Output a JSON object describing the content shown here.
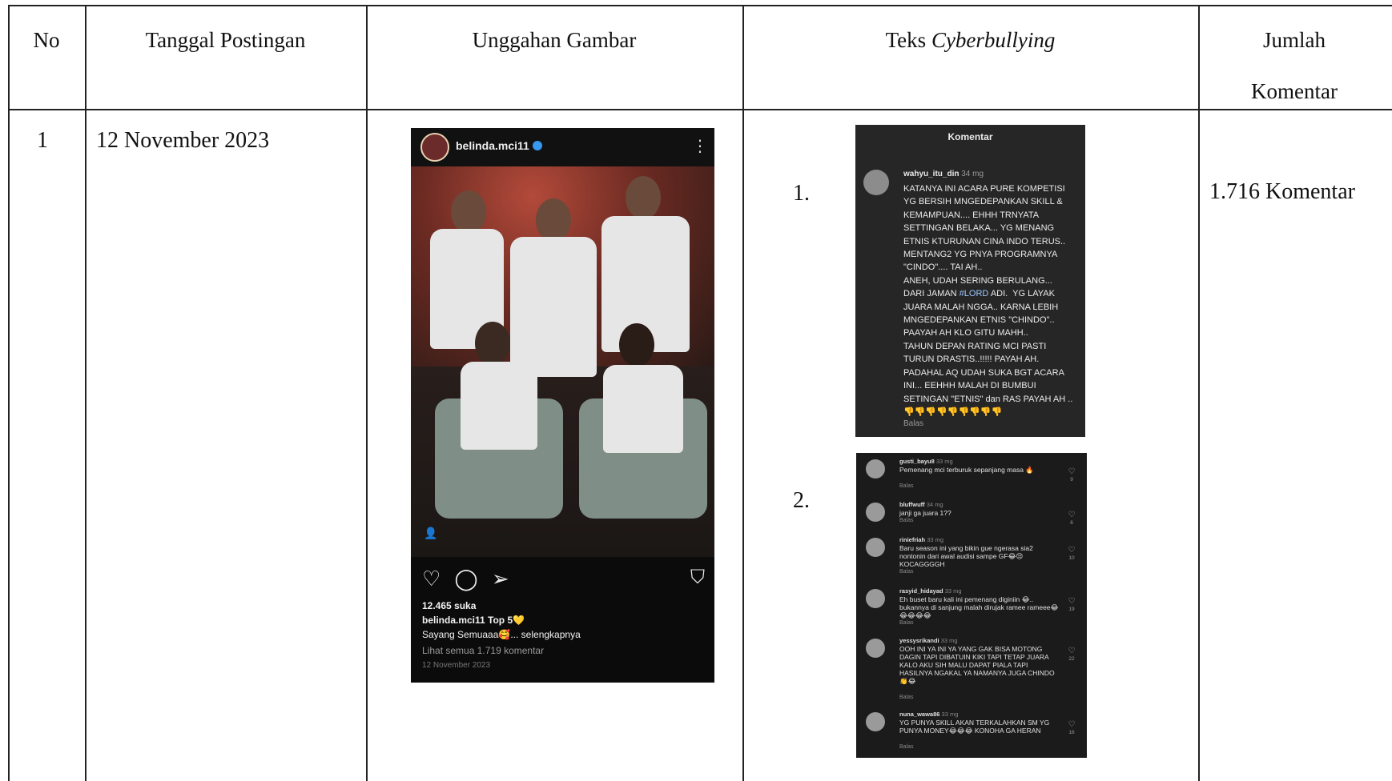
{
  "table": {
    "headers": {
      "no": "No",
      "tanggal": "Tanggal Postingan",
      "unggahan": "Unggahan Gambar",
      "teks_prefix": "Teks ",
      "teks_italic": "Cyberbullying",
      "jumlah_1": "Jumlah",
      "jumlah_2": "Komentar"
    },
    "row": {
      "no": "1",
      "tanggal": "12 November 2023",
      "jumlah": "1.716 Komentar",
      "item1_num": "1.",
      "item2_num": "2."
    }
  },
  "post": {
    "username": "belinda.mci11",
    "likes": "12.465 suka",
    "caption": "belinda.mci11 Top 5💛",
    "caption2": "Sayang Semuaaa🥰... selengkapnya",
    "view_comments": "Lihat semua 1.719 komentar",
    "date": "12 November 2023"
  },
  "comment1": {
    "title": "Komentar",
    "user": "wahyu_itu_din",
    "time": "34 mg",
    "body_a": "KATANYA INI ACARA PURE KOMPETISI YG BERSIH MNGEDEPANKAN SKILL & KEMAMPUAN.... EHHH TRNYATA SETTINGAN BELAKA... YG MENANG ETNIS KTURUNAN CINA INDO TERUS.. MENTANG2 YG PNYA PROGRAMNYA \"CINDO\".... TAI AH..\nANEH, UDAH SERING BERULANG... DARI JAMAN ",
    "body_tag": "#LORD",
    "body_b": " ADI.  YG LAYAK JUARA MALAH NGGA.. KARNA LEBIH MNGEDEPANKAN ETNIS \"CHINDO\".. PAAYAH AH KLO GITU MAHH..\nTAHUN DEPAN RATING MCI PASTI TURUN DRASTIS..!!!!! PAYAH AH.\nPADAHAL AQ UDAH SUKA BGT ACARA INI... EEHHH MALAH DI BUMBUI SETINGAN \"ETNIS\" dan RAS PAYAH AH ..👎👎👎👎👎👎👎👎👎",
    "reply": "Balas"
  },
  "comments2": [
    {
      "user": "gusti_bayu8",
      "time": "33 mg",
      "text": "Pemenang mci terburuk sepanjang masa 🔥",
      "reply": "Balas",
      "likes": "9"
    },
    {
      "user": "bluffwuff",
      "time": "34 mg",
      "text": "janji ga juara 1??",
      "reply": "Balas",
      "likes": "6"
    },
    {
      "user": "riniefriah",
      "time": "33 mg",
      "text": "Baru season ini yang bikin gue ngerasa sia2 nontonin dari awal audisi sampe GF😂😒 KOCAGGGGH",
      "reply": "Balas",
      "likes": "10"
    },
    {
      "user": "rasyid_hidayad",
      "time": "33 mg",
      "text": "Eh buset baru kali ini pemenang diginiin 😂.. bukannya di sanjung malah dirujak ramee rameee😂😂😂😂😂",
      "reply": "Balas",
      "likes": "19"
    },
    {
      "user": "yessysrikandi",
      "time": "33 mg",
      "text": "OOH INI YA INI YA YANG GAK BISA MOTONG DAGIN TAPI DIBATUIN KIKI TAPI TETAP JUARA KALO AKU SIH MALU DAPAT PIALA TAPI HASILNYA NGAKAL YA NAMANYA JUGA CHINDO 👏😂",
      "reply": "Balas",
      "likes": "22"
    },
    {
      "user": "nuna_wawa86",
      "time": "33 mg",
      "text": "YG PUNYA SKILL AKAN TERKALAHKAN SM YG PUNYA MONEY😂😂😂 KONOHA GA HERAN",
      "reply": "Balas",
      "likes": "16"
    }
  ],
  "icons": {
    "heart": "♡",
    "comment": "◯",
    "send": "➢",
    "bookmark": "⛉",
    "more": "⋮",
    "person": "👤"
  }
}
